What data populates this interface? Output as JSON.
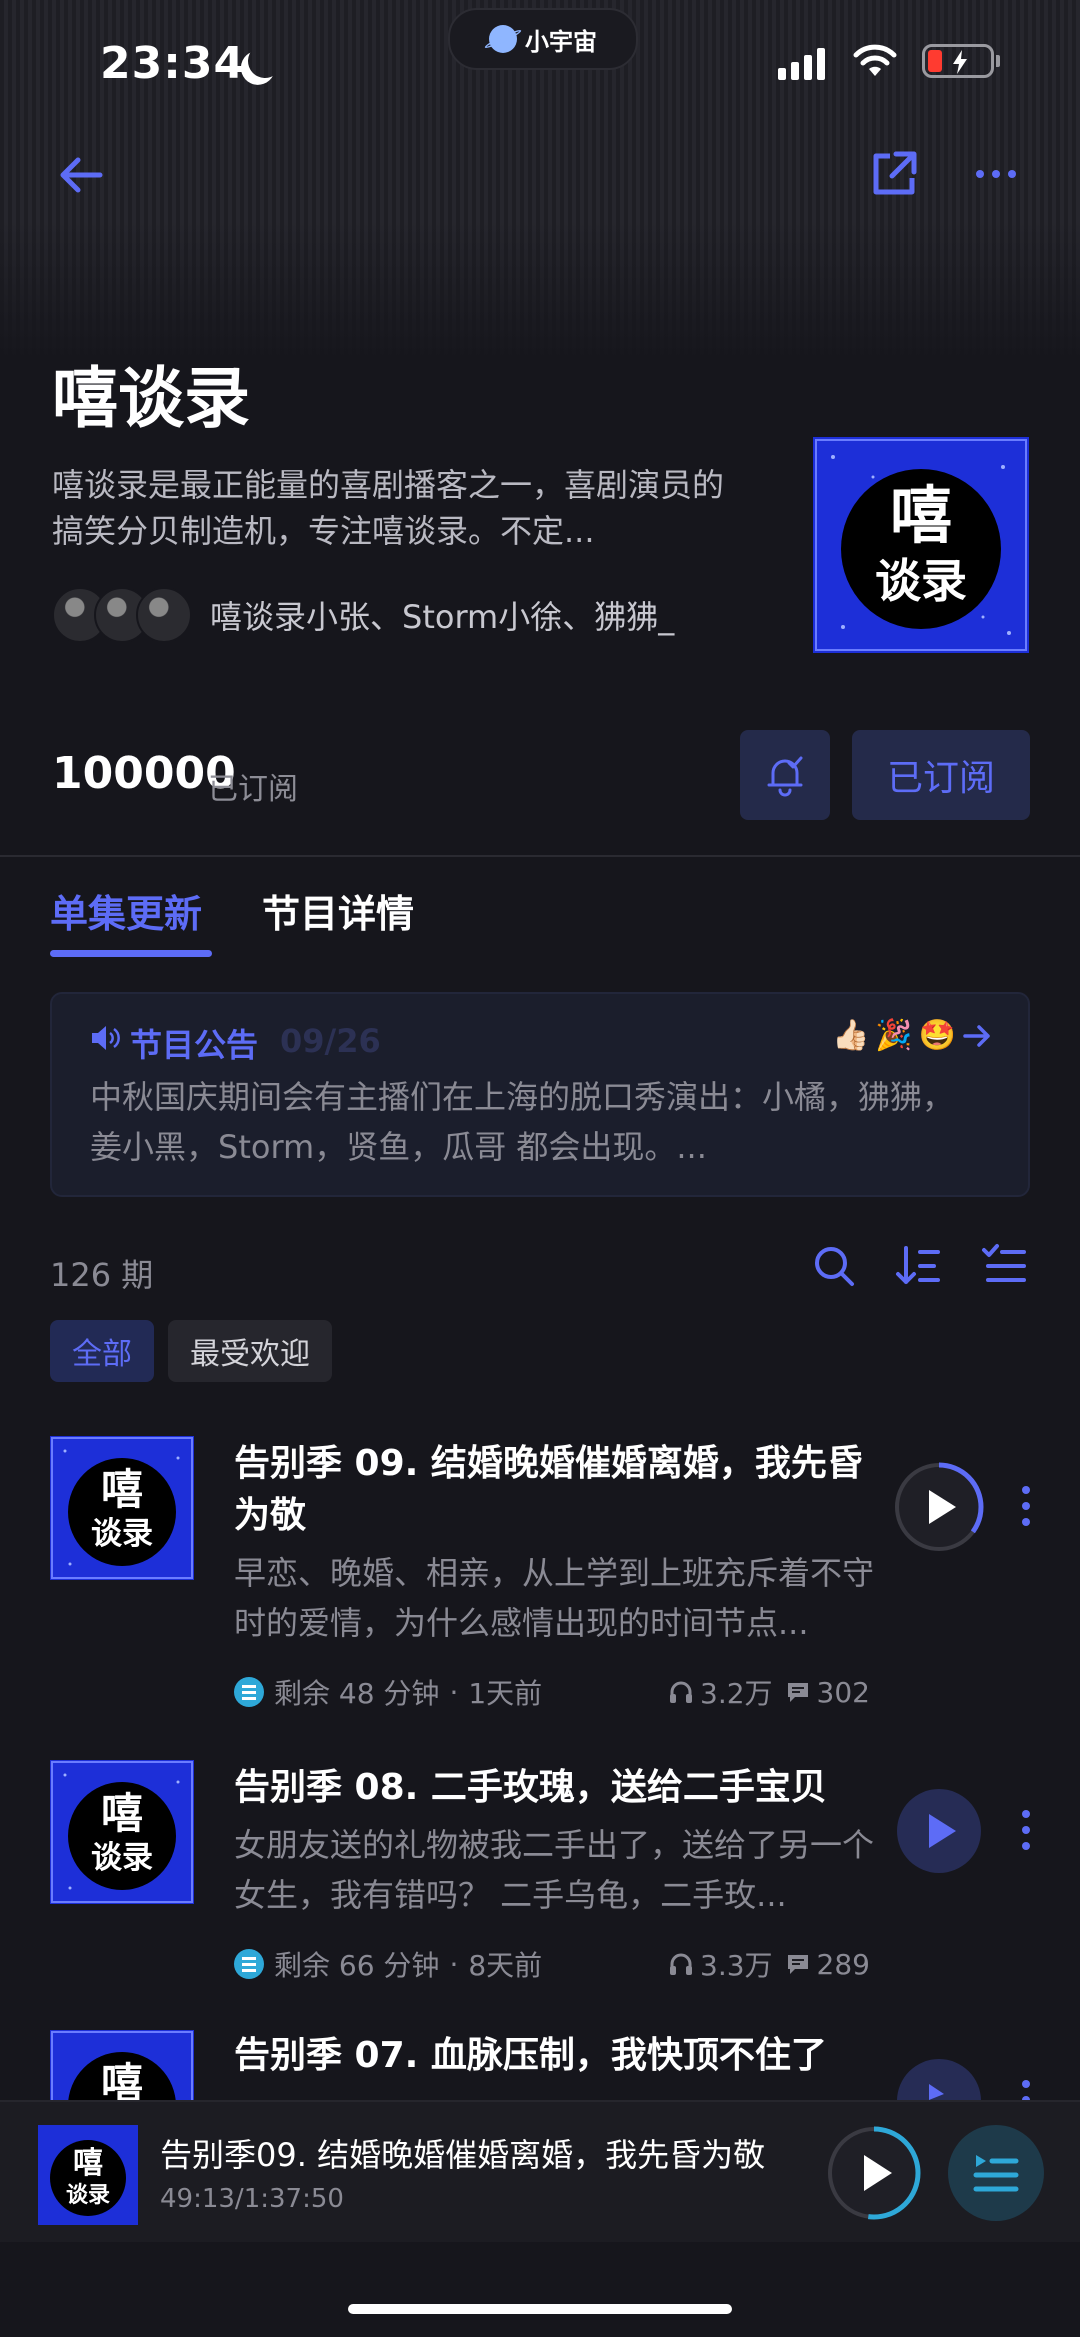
{
  "status_bar": {
    "time": "23:34",
    "island_label": "小宇宙"
  },
  "header": {
    "back_icon": "arrow-left-icon",
    "share_icon": "share-icon",
    "more_icon": "more-horizontal-icon"
  },
  "podcast": {
    "title": "嘻谈录",
    "description": "嘻谈录是最正能量的喜剧播客之一，喜剧演员的搞笑分贝制造机，专注嘻谈录。不定...",
    "hosts": "嘻谈录小张、Storm小徐、狒狒_",
    "cover_text": "嘻谈录",
    "subscriber_count": "100000",
    "subscriber_label": "已订阅",
    "subscribe_button": "已订阅"
  },
  "tabs": [
    {
      "label": "单集更新",
      "active": true
    },
    {
      "label": "节目详情",
      "active": false
    }
  ],
  "notice": {
    "title": "节目公告",
    "date": "09/26",
    "emojis": [
      "👍🏻",
      "🎉",
      "🤩"
    ],
    "body": "中秋国庆期间会有主播们在上海的脱口秀演出：小橘，狒狒，姜小黑，Storm，贤鱼，瓜哥 都会出现。..."
  },
  "episodes_header": {
    "count": "126 期",
    "filters": [
      "全部",
      "最受欢迎"
    ]
  },
  "episodes": [
    {
      "title": "告别季 09. 结婚晚婚催婚离婚，我先昏为敬",
      "desc": "早恋、晚婚、相亲，从上学到上班充斥着不守时的爱情，为什么感情出现的时间节点...",
      "remaining": "剩余 48 分钟",
      "ago": "1天前",
      "plays": "3.2万",
      "comments": "302",
      "progress": 0.35
    },
    {
      "title": "告别季 08. 二手玫瑰，送给二手宝贝",
      "desc": "女朋友送的礼物被我二手出了，送给了另一个女生，我有错吗？ 二手乌龟，二手玫...",
      "remaining": "剩余 66 分钟",
      "ago": "8天前",
      "plays": "3.3万",
      "comments": "289",
      "progress": 0
    },
    {
      "title": "告别季 07. 血脉压制，我快顶不住了"
    }
  ],
  "player": {
    "title": "告别季09. 结婚晚婚催婚离婚，我先昏为敬",
    "time": "49:13/1:37:50",
    "progress": 0.52
  },
  "colors": {
    "accent": "#5d6cf6",
    "background": "#16161c"
  }
}
